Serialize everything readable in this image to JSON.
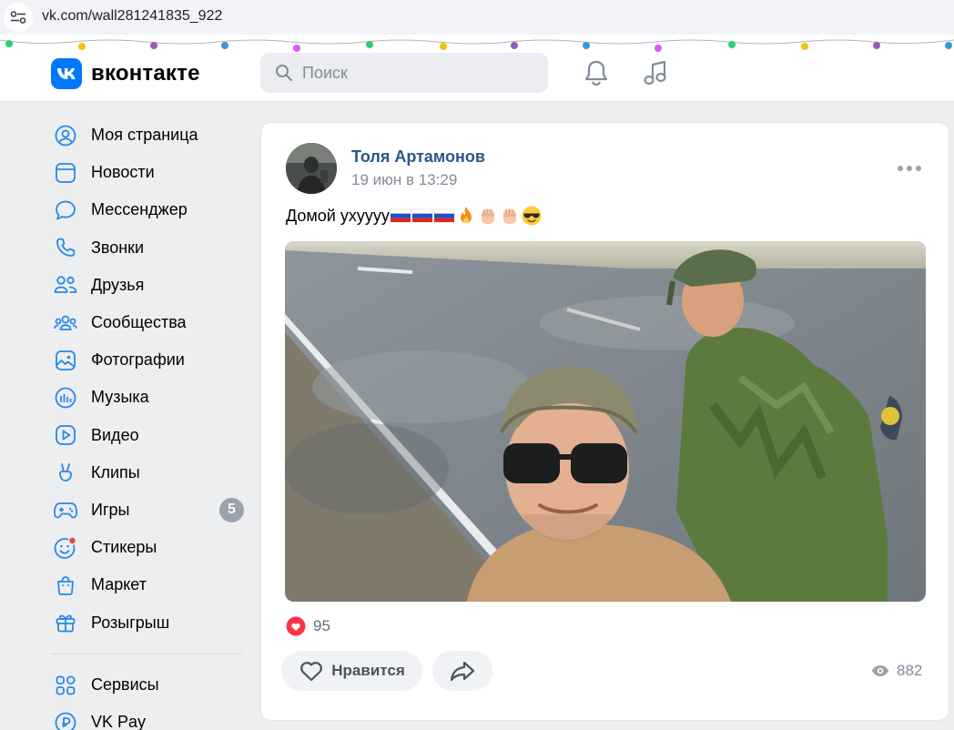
{
  "browser": {
    "url": "vk.com/wall281241835_922"
  },
  "header": {
    "logo_text": "вконтакте",
    "search_placeholder": "Поиск",
    "brand_color": "#0077ff"
  },
  "sidebar": {
    "items": [
      {
        "label": "Моя страница",
        "icon": "user-circle-icon"
      },
      {
        "label": "Новости",
        "icon": "news-icon"
      },
      {
        "label": "Мессенджер",
        "icon": "message-bubble-icon"
      },
      {
        "label": "Звонки",
        "icon": "phone-icon"
      },
      {
        "label": "Друзья",
        "icon": "friends-icon"
      },
      {
        "label": "Сообщества",
        "icon": "communities-icon"
      },
      {
        "label": "Фотографии",
        "icon": "photo-icon"
      },
      {
        "label": "Музыка",
        "icon": "music-bars-icon"
      },
      {
        "label": "Видео",
        "icon": "video-play-icon"
      },
      {
        "label": "Клипы",
        "icon": "clips-hand-icon"
      },
      {
        "label": "Игры",
        "icon": "gamepad-icon",
        "badge": "5"
      },
      {
        "label": "Стикеры",
        "icon": "sticker-smile-icon"
      },
      {
        "label": "Маркет",
        "icon": "shopping-bag-icon"
      },
      {
        "label": "Розыгрыш",
        "icon": "gift-icon"
      }
    ],
    "secondary": [
      {
        "label": "Сервисы",
        "icon": "services-grid-icon"
      },
      {
        "label": "VK Pay",
        "icon": "vk-pay-icon"
      }
    ]
  },
  "post": {
    "author": "Толя Артамонов",
    "time": "19 июн в 13:29",
    "text": "Домой ухуууу",
    "emoji": [
      "flag-russia",
      "flag-russia",
      "flag-russia",
      "fire",
      "raised-fist",
      "raised-fist",
      "sunglasses-face"
    ],
    "likes": "95",
    "like_label": "Нравится",
    "views": "882"
  }
}
